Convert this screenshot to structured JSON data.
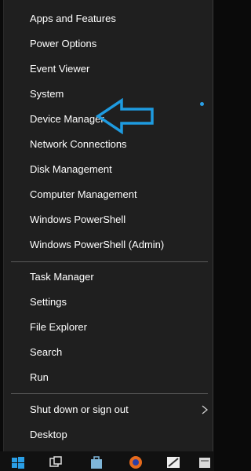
{
  "menu": {
    "items": [
      {
        "label": "Apps and Features"
      },
      {
        "label": "Power Options"
      },
      {
        "label": "Event Viewer"
      },
      {
        "label": "System"
      },
      {
        "label": "Device Manager"
      },
      {
        "label": "Network Connections"
      },
      {
        "label": "Disk Management"
      },
      {
        "label": "Computer Management"
      },
      {
        "label": "Windows PowerShell"
      },
      {
        "label": "Windows PowerShell (Admin)"
      },
      {
        "label": "Task Manager"
      },
      {
        "label": "Settings"
      },
      {
        "label": "File Explorer"
      },
      {
        "label": "Search"
      },
      {
        "label": "Run"
      },
      {
        "label": "Shut down or sign out"
      },
      {
        "label": "Desktop"
      }
    ]
  },
  "colors": {
    "menu_bg": "#1f1f1f",
    "text": "#ffffff",
    "annotation_arrow": "#1e9be0",
    "separator": "#5a5a5a"
  },
  "icons": [
    "chevron-right-icon",
    "left-arrow-annotation",
    "windows-logo-icon",
    "task-view-icon",
    "store-icon",
    "firefox-icon",
    "app-icon"
  ]
}
